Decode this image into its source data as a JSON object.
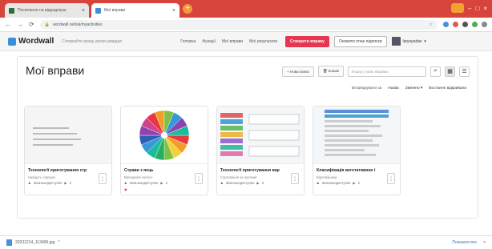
{
  "browser": {
    "tabs": [
      {
        "title": "Посилання на відрадокуш",
        "favicon_color": "#2a6e3a"
      },
      {
        "title": "Мої вправи",
        "favicon_color": "#3a8fd9"
      }
    ],
    "url": "wordwall.net/uk/myactivities"
  },
  "site": {
    "logo": "Wordwall",
    "slogan": "Створюйте кращі уроки швидше",
    "nav": [
      "Головна",
      "Функції",
      "Мої вправи",
      "Мої результати"
    ],
    "create_label": "Створити вправу",
    "upgrade_label": "Оновити план підписки",
    "username": "larysyudav"
  },
  "page": {
    "title": "Мої вправи",
    "new_folder": "+ Нова папка",
    "trash": "Кошик",
    "search_placeholder": "Пошук у моїх вправах",
    "sort_label": "Впорядкувати за",
    "sort_options": [
      "Назва",
      "Змінено ▾",
      "Востаннє відкривали"
    ]
  },
  "cards": [
    {
      "name": "Технології приготування стр",
      "type": "Навідуть порядок",
      "visibility": "Загальнодоступно",
      "plays": "2"
    },
    {
      "name": "Страви з яєць",
      "type": "Випадкове колесо",
      "visibility": "Загальнодоступно",
      "plays": "4"
    },
    {
      "name": "Технології приготування вар",
      "type": "Сортування за групами",
      "visibility": "Загальнодоступно",
      "plays": "3"
    },
    {
      "name": "Класифікація вегетативних і",
      "type": "Відповідники",
      "visibility": "Загальнодоступно",
      "plays": "2"
    }
  ],
  "wheel_colors": [
    "#e6393d",
    "#f39c2b",
    "#f4d03f",
    "#7dc242",
    "#27ae60",
    "#1abc9c",
    "#3498db",
    "#2f5fb3",
    "#8e44ad",
    "#d1438f",
    "#e6393d",
    "#f39c2b",
    "#7dc242",
    "#3498db",
    "#8e44ad",
    "#1abc9c"
  ],
  "download": {
    "file": "20231214_113400.jpg",
    "show_all": "Показати все"
  }
}
